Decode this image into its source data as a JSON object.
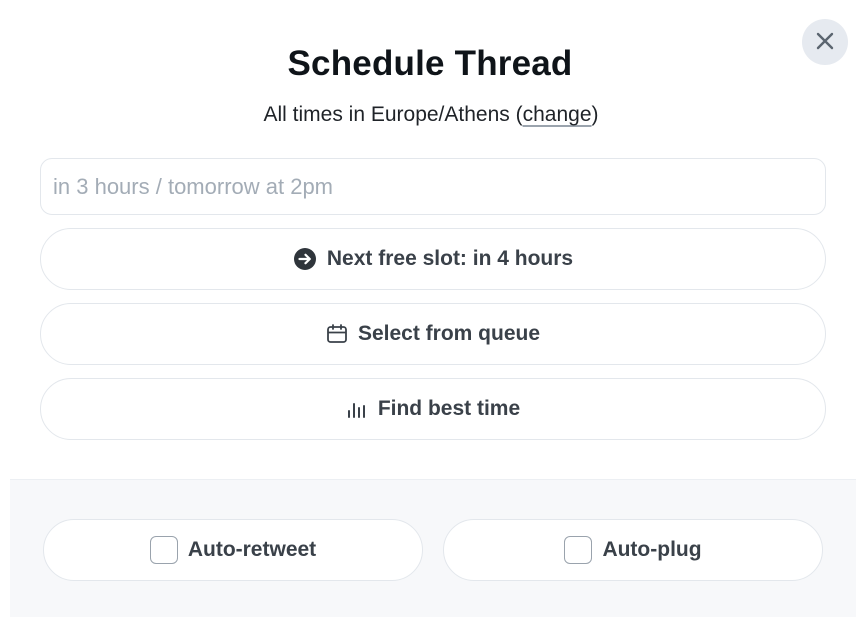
{
  "dialog": {
    "title": "Schedule Thread",
    "timezone_prefix": "All times in Europe/Athens (",
    "timezone_link": "change",
    "timezone_suffix": ")",
    "close_icon": "close-icon"
  },
  "schedule_input": {
    "value": "",
    "placeholder": "in 3 hours / tomorrow at 2pm"
  },
  "actions": {
    "next_slot": {
      "label": "Next free slot: in 4 hours",
      "icon": "arrow-right-circle-icon"
    },
    "queue": {
      "label": "Select from queue",
      "icon": "calendar-icon"
    },
    "best_time": {
      "label": "Find best time",
      "icon": "bar-chart-icon"
    }
  },
  "options": {
    "auto_retweet": {
      "label": "Auto-retweet",
      "checked": false
    },
    "auto_plug": {
      "label": "Auto-plug",
      "checked": false
    }
  },
  "colors": {
    "title": "#0f1419",
    "button_text": "#3a4149",
    "border": "#e3e7ec",
    "footer_bg": "#f7f8fa",
    "close_bg": "#e6eaf0"
  }
}
